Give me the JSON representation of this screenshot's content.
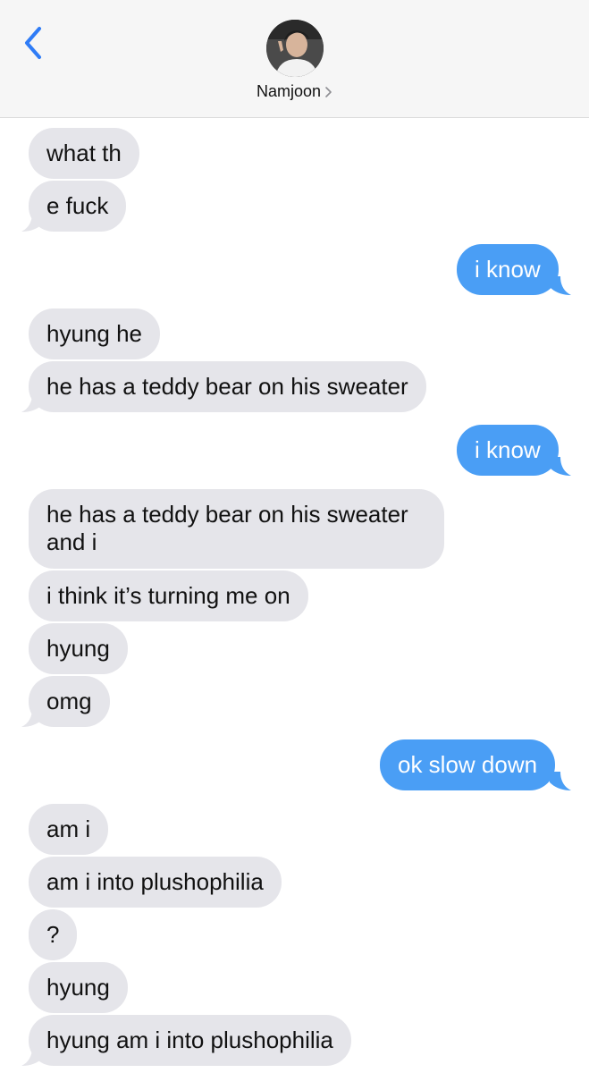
{
  "header": {
    "contact_name": "Namjoon",
    "back_icon": "chevron-left-icon",
    "avatar": "contact-avatar"
  },
  "colors": {
    "received_bubble": "#e5e5ea",
    "sent_bubble": "#4a9ef5",
    "back_accent": "#2f7cf6"
  },
  "messages": [
    {
      "from": "them",
      "text": "what th"
    },
    {
      "from": "them",
      "text": "e fuck"
    },
    {
      "from": "me",
      "text": "i know"
    },
    {
      "from": "them",
      "text": "hyung he"
    },
    {
      "from": "them",
      "text": "he has a teddy bear on his sweater"
    },
    {
      "from": "me",
      "text": "i know"
    },
    {
      "from": "them",
      "text": "he has a teddy bear on his sweater and i"
    },
    {
      "from": "them",
      "text": "i think it’s turning me on"
    },
    {
      "from": "them",
      "text": "hyung"
    },
    {
      "from": "them",
      "text": "omg"
    },
    {
      "from": "me",
      "text": "ok slow down"
    },
    {
      "from": "them",
      "text": "am i"
    },
    {
      "from": "them",
      "text": "am i into plushophilia"
    },
    {
      "from": "them",
      "text": "?"
    },
    {
      "from": "them",
      "text": "hyung"
    },
    {
      "from": "them",
      "text": "hyung am i into plushophilia"
    }
  ]
}
